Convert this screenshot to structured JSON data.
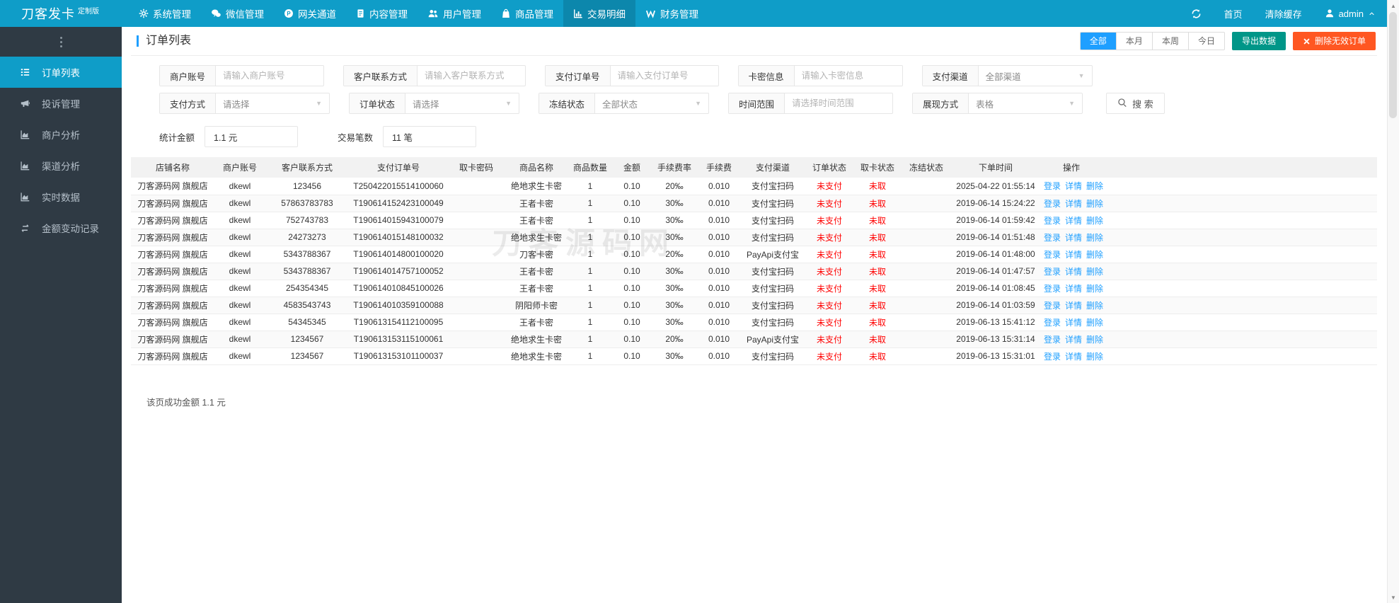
{
  "brand": {
    "name": "刀客发卡",
    "badge": "定制版"
  },
  "colors": {
    "accent": "#0F9DC8",
    "accent_dark": "#0C87AC",
    "sidebar_bg": "#2F3A44",
    "blue": "#1E9FFF",
    "green": "#009688",
    "orange": "#FF5722",
    "status_red": "#FF0000",
    "link_blue": "#1E9FFF"
  },
  "topnav": {
    "items": [
      {
        "label": "系统管理",
        "icon": "gear-icon",
        "active": false
      },
      {
        "label": "微信管理",
        "icon": "wechat-icon",
        "active": false
      },
      {
        "label": "网关通道",
        "icon": "gateway-icon",
        "active": false
      },
      {
        "label": "内容管理",
        "icon": "content-icon",
        "active": false
      },
      {
        "label": "用户管理",
        "icon": "users-icon",
        "active": false
      },
      {
        "label": "商品管理",
        "icon": "goods-icon",
        "active": false
      },
      {
        "label": "交易明细",
        "icon": "chart-bar-icon",
        "active": true
      },
      {
        "label": "财务管理",
        "icon": "finance-icon",
        "active": false
      }
    ],
    "right": {
      "home": "首页",
      "clear_cache": "清除缓存",
      "user": "admin"
    }
  },
  "sidebar": {
    "items": [
      {
        "label": "订单列表",
        "icon": "list-icon",
        "active": true
      },
      {
        "label": "投诉管理",
        "icon": "megaphone-icon",
        "active": false
      },
      {
        "label": "商户分析",
        "icon": "chart-area-icon",
        "active": false
      },
      {
        "label": "渠道分析",
        "icon": "chart-area-icon",
        "active": false
      },
      {
        "label": "实时数据",
        "icon": "chart-area-icon",
        "active": false
      },
      {
        "label": "金额变动记录",
        "icon": "exchange-icon",
        "active": false
      }
    ]
  },
  "page": {
    "title": "订单列表",
    "range_tabs": [
      {
        "label": "全部",
        "active": true
      },
      {
        "label": "本月",
        "active": false
      },
      {
        "label": "本周",
        "active": false
      },
      {
        "label": "今日",
        "active": false
      }
    ],
    "export_button": "导出数据",
    "delete_button": "删除无效订单",
    "watermark": "刀客源码网",
    "footer_summary": "该页成功金额 1.1 元"
  },
  "filters": {
    "row1": [
      {
        "label": "商户账号",
        "type": "input",
        "placeholder": "请输入商户账号"
      },
      {
        "label": "客户联系方式",
        "type": "input",
        "placeholder": "请输入客户联系方式"
      },
      {
        "label": "支付订单号",
        "type": "input",
        "placeholder": "请输入支付订单号"
      },
      {
        "label": "卡密信息",
        "type": "input",
        "placeholder": "请输入卡密信息"
      },
      {
        "label": "支付渠道",
        "type": "select",
        "value": "全部渠道"
      }
    ],
    "row2": [
      {
        "label": "支付方式",
        "type": "select",
        "value": "请选择"
      },
      {
        "label": "订单状态",
        "type": "select",
        "value": "请选择"
      },
      {
        "label": "冻结状态",
        "type": "select",
        "value": "全部状态"
      },
      {
        "label": "时间范围",
        "type": "input",
        "placeholder": "请选择时间范围"
      },
      {
        "label": "展现方式",
        "type": "select",
        "value": "表格"
      }
    ],
    "search_button": "搜 索",
    "stats": [
      {
        "label": "统计金额",
        "value": "1.1 元"
      },
      {
        "label": "交易笔数",
        "value": "11 笔"
      }
    ]
  },
  "table": {
    "columns": [
      "店铺名称",
      "商户账号",
      "客户联系方式",
      "支付订单号",
      "取卡密码",
      "商品名称",
      "商品数量",
      "金额",
      "手续费率",
      "手续费",
      "支付渠道",
      "订单状态",
      "取卡状态",
      "冻结状态",
      "下单时间",
      "操作"
    ],
    "actions": [
      "登录",
      "详情",
      "删除"
    ],
    "rows": [
      [
        "刀客源码网 旗舰店",
        "dkewl",
        "123456",
        "T250422015514100060",
        "",
        "绝地求生卡密",
        "1",
        "0.10",
        "20‰",
        "0.010",
        "支付宝扫码",
        "未支付",
        "未取",
        "",
        "2025-04-22 01:55:14"
      ],
      [
        "刀客源码网 旗舰店",
        "dkewl",
        "57863783783",
        "T190614152423100049",
        "",
        "王者卡密",
        "1",
        "0.10",
        "30‰",
        "0.010",
        "支付宝扫码",
        "未支付",
        "未取",
        "",
        "2019-06-14 15:24:22"
      ],
      [
        "刀客源码网 旗舰店",
        "dkewl",
        "752743783",
        "T190614015943100079",
        "",
        "王者卡密",
        "1",
        "0.10",
        "30‰",
        "0.010",
        "支付宝扫码",
        "未支付",
        "未取",
        "",
        "2019-06-14 01:59:42"
      ],
      [
        "刀客源码网 旗舰店",
        "dkewl",
        "24273273",
        "T190614015148100032",
        "",
        "绝地求生卡密",
        "1",
        "0.10",
        "30‰",
        "0.010",
        "支付宝扫码",
        "未支付",
        "未取",
        "",
        "2019-06-14 01:51:48"
      ],
      [
        "刀客源码网 旗舰店",
        "dkewl",
        "5343788367",
        "T190614014800100020",
        "",
        "刀客卡密",
        "1",
        "0.10",
        "20‰",
        "0.010",
        "PayApi支付宝",
        "未支付",
        "未取",
        "",
        "2019-06-14 01:48:00"
      ],
      [
        "刀客源码网 旗舰店",
        "dkewl",
        "5343788367",
        "T190614014757100052",
        "",
        "王者卡密",
        "1",
        "0.10",
        "30‰",
        "0.010",
        "支付宝扫码",
        "未支付",
        "未取",
        "",
        "2019-06-14 01:47:57"
      ],
      [
        "刀客源码网 旗舰店",
        "dkewl",
        "254354345",
        "T190614010845100026",
        "",
        "王者卡密",
        "1",
        "0.10",
        "30‰",
        "0.010",
        "支付宝扫码",
        "未支付",
        "未取",
        "",
        "2019-06-14 01:08:45"
      ],
      [
        "刀客源码网 旗舰店",
        "dkewl",
        "4583543743",
        "T190614010359100088",
        "",
        "阴阳师卡密",
        "1",
        "0.10",
        "30‰",
        "0.010",
        "支付宝扫码",
        "未支付",
        "未取",
        "",
        "2019-06-14 01:03:59"
      ],
      [
        "刀客源码网 旗舰店",
        "dkewl",
        "54345345",
        "T190613154112100095",
        "",
        "王者卡密",
        "1",
        "0.10",
        "30‰",
        "0.010",
        "支付宝扫码",
        "未支付",
        "未取",
        "",
        "2019-06-13 15:41:12"
      ],
      [
        "刀客源码网 旗舰店",
        "dkewl",
        "1234567",
        "T190613153115100061",
        "",
        "绝地求生卡密",
        "1",
        "0.10",
        "20‰",
        "0.010",
        "PayApi支付宝",
        "未支付",
        "未取",
        "",
        "2019-06-13 15:31:14"
      ],
      [
        "刀客源码网 旗舰店",
        "dkewl",
        "1234567",
        "T190613153101100037",
        "",
        "绝地求生卡密",
        "1",
        "0.10",
        "30‰",
        "0.010",
        "支付宝扫码",
        "未支付",
        "未取",
        "",
        "2019-06-13 15:31:01"
      ]
    ]
  }
}
